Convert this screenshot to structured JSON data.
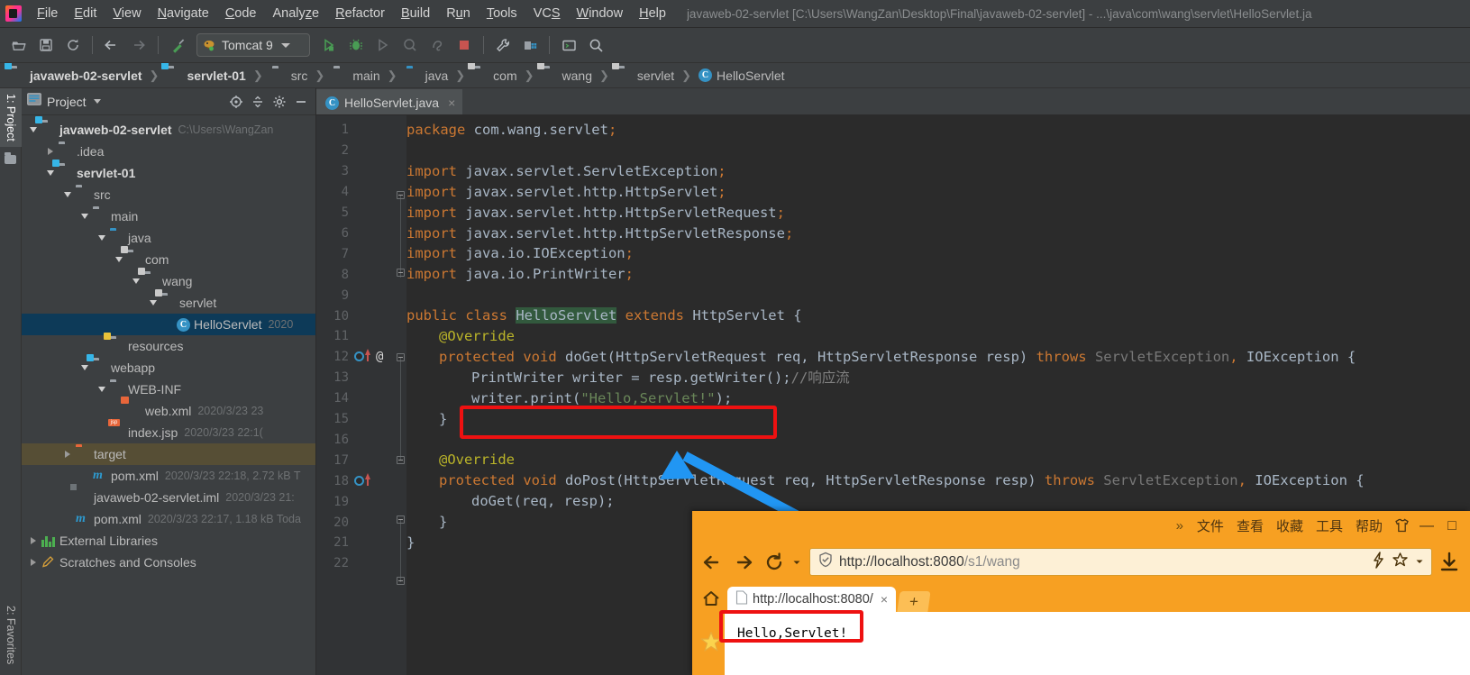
{
  "window": {
    "title": "javaweb-02-servlet [C:\\Users\\WangZan\\Desktop\\Final\\javaweb-02-servlet] - ...\\java\\com\\wang\\servlet\\HelloServlet.ja"
  },
  "menu": {
    "items": [
      {
        "label": "File",
        "mnemonic": "F"
      },
      {
        "label": "Edit",
        "mnemonic": "E"
      },
      {
        "label": "View",
        "mnemonic": "V"
      },
      {
        "label": "Navigate",
        "mnemonic": "N"
      },
      {
        "label": "Code",
        "mnemonic": "C"
      },
      {
        "label": "Analyze",
        "mnemonic": "z"
      },
      {
        "label": "Refactor",
        "mnemonic": "R"
      },
      {
        "label": "Build",
        "mnemonic": "B"
      },
      {
        "label": "Run",
        "mnemonic": "u"
      },
      {
        "label": "Tools",
        "mnemonic": "T"
      },
      {
        "label": "VCS",
        "mnemonic": "S"
      },
      {
        "label": "Window",
        "mnemonic": "W"
      },
      {
        "label": "Help",
        "mnemonic": "H"
      }
    ]
  },
  "toolbar": {
    "run_config": "Tomcat 9",
    "icons": [
      "open-folder-icon",
      "save-all-icon",
      "sync-icon",
      "back-icon",
      "forward-icon",
      "build-icon"
    ],
    "run_icons": [
      "run-icon",
      "debug-icon",
      "run-with-coverage-icon",
      "profile-icon",
      "attach-icon",
      "stop-icon"
    ],
    "right_icons": [
      "settings-icon",
      "project-structure-icon",
      "terminal-icon",
      "search-icon"
    ]
  },
  "breadcrumb": {
    "items": [
      {
        "label": "javaweb-02-servlet",
        "icon": "module-folder-icon",
        "bold": true
      },
      {
        "label": "servlet-01",
        "icon": "module-folder-icon",
        "bold": true
      },
      {
        "label": "src",
        "icon": "folder-icon",
        "bold": false
      },
      {
        "label": "main",
        "icon": "folder-icon",
        "bold": false
      },
      {
        "label": "java",
        "icon": "source-folder-icon",
        "bold": false
      },
      {
        "label": "com",
        "icon": "package-icon",
        "bold": false
      },
      {
        "label": "wang",
        "icon": "package-icon",
        "bold": false
      },
      {
        "label": "servlet",
        "icon": "package-icon",
        "bold": false
      },
      {
        "label": "HelloServlet",
        "icon": "class-icon",
        "bold": false
      }
    ]
  },
  "left_strip": {
    "project_tab": "1: Project",
    "favorites_tab": "2: Favorites"
  },
  "project_panel": {
    "title": "Project",
    "actions": [
      "locate-icon",
      "collapse-all-icon",
      "settings-icon",
      "hide-icon"
    ],
    "tree": [
      {
        "depth": 0,
        "label": "javaweb-02-servlet",
        "meta": "C:\\Users\\WangZan",
        "icon": "module-folder-icon",
        "expanded": true,
        "bold": true,
        "selected": false
      },
      {
        "depth": 1,
        "label": ".idea",
        "meta": "",
        "icon": "folder-icon",
        "expanded": false,
        "bold": false,
        "selected": false
      },
      {
        "depth": 1,
        "label": "servlet-01",
        "meta": "",
        "icon": "module-folder-icon",
        "expanded": true,
        "bold": true,
        "selected": false
      },
      {
        "depth": 2,
        "label": "src",
        "meta": "",
        "icon": "folder-icon",
        "expanded": true,
        "bold": false,
        "selected": false
      },
      {
        "depth": 3,
        "label": "main",
        "meta": "",
        "icon": "folder-icon",
        "expanded": true,
        "bold": false,
        "selected": false
      },
      {
        "depth": 4,
        "label": "java",
        "meta": "",
        "icon": "source-folder-icon",
        "expanded": true,
        "bold": false,
        "selected": false
      },
      {
        "depth": 5,
        "label": "com",
        "meta": "",
        "icon": "package-icon",
        "expanded": true,
        "bold": false,
        "selected": false
      },
      {
        "depth": 6,
        "label": "wang",
        "meta": "",
        "icon": "package-icon",
        "expanded": true,
        "bold": false,
        "selected": false
      },
      {
        "depth": 7,
        "label": "servlet",
        "meta": "",
        "icon": "package-icon",
        "expanded": true,
        "bold": false,
        "selected": false
      },
      {
        "depth": 8,
        "label": "HelloServlet",
        "meta": "2020",
        "icon": "class-icon",
        "expanded": null,
        "bold": false,
        "selected": true
      },
      {
        "depth": 4,
        "label": "resources",
        "meta": "",
        "icon": "resources-folder-icon",
        "expanded": null,
        "bold": false,
        "selected": false
      },
      {
        "depth": 3,
        "label": "webapp",
        "meta": "",
        "icon": "webapp-folder-icon",
        "expanded": true,
        "bold": false,
        "selected": false
      },
      {
        "depth": 4,
        "label": "WEB-INF",
        "meta": "",
        "icon": "folder-icon",
        "expanded": true,
        "bold": false,
        "selected": false
      },
      {
        "depth": 5,
        "label": "web.xml",
        "meta": "2020/3/23 23",
        "icon": "xml-file-icon",
        "expanded": null,
        "bold": false,
        "selected": false
      },
      {
        "depth": 4,
        "label": "index.jsp",
        "meta": "2020/3/23 22:1(",
        "icon": "jsp-file-icon",
        "expanded": null,
        "bold": false,
        "selected": false
      },
      {
        "depth": 2,
        "label": "target",
        "meta": "",
        "icon": "target-folder-icon",
        "expanded": false,
        "bold": false,
        "selected": false,
        "highlighted": true
      },
      {
        "depth": 3,
        "label": "pom.xml",
        "meta": "2020/3/23 22:18, 2.72 kB T",
        "icon": "maven-file-icon",
        "expanded": null,
        "bold": false,
        "selected": false
      },
      {
        "depth": 2,
        "label": "javaweb-02-servlet.iml",
        "meta": "2020/3/23 21:",
        "icon": "iml-file-icon",
        "expanded": null,
        "bold": false,
        "selected": false
      },
      {
        "depth": 2,
        "label": "pom.xml",
        "meta": "2020/3/23 22:17, 1.18 kB Toda",
        "icon": "maven-file-icon",
        "expanded": null,
        "bold": false,
        "selected": false
      },
      {
        "depth": 0,
        "label": "External Libraries",
        "meta": "",
        "icon": "libraries-icon",
        "expanded": false,
        "bold": false,
        "selected": false
      },
      {
        "depth": 0,
        "label": "Scratches and Consoles",
        "meta": "",
        "icon": "scratches-icon",
        "expanded": false,
        "bold": false,
        "selected": false
      }
    ]
  },
  "editor": {
    "tab": {
      "label": "HelloServlet.java",
      "icon": "class-icon",
      "close": "×"
    },
    "line_numbers": [
      1,
      2,
      3,
      4,
      5,
      6,
      7,
      8,
      9,
      10,
      11,
      12,
      13,
      14,
      15,
      16,
      17,
      18,
      19,
      20,
      21,
      22
    ],
    "code_lines": [
      {
        "n": 1,
        "indent": 0,
        "parts": [
          {
            "t": "package",
            "c": "k"
          },
          {
            "t": " com.wang.servlet",
            "c": "t"
          },
          {
            "t": ";",
            "c": "k"
          }
        ]
      },
      {
        "n": 2,
        "indent": 0,
        "parts": []
      },
      {
        "n": 3,
        "indent": 0,
        "parts": [
          {
            "t": "import",
            "c": "k"
          },
          {
            "t": " javax.servlet.ServletException",
            "c": "t"
          },
          {
            "t": ";",
            "c": "k"
          }
        ]
      },
      {
        "n": 4,
        "indent": 0,
        "parts": [
          {
            "t": "import",
            "c": "k"
          },
          {
            "t": " javax.servlet.http.HttpServlet",
            "c": "t"
          },
          {
            "t": ";",
            "c": "k"
          }
        ]
      },
      {
        "n": 5,
        "indent": 0,
        "parts": [
          {
            "t": "import",
            "c": "k"
          },
          {
            "t": " javax.servlet.http.HttpServletRequest",
            "c": "t"
          },
          {
            "t": ";",
            "c": "k"
          }
        ]
      },
      {
        "n": 6,
        "indent": 0,
        "parts": [
          {
            "t": "import",
            "c": "k"
          },
          {
            "t": " javax.servlet.http.HttpServletResponse",
            "c": "t"
          },
          {
            "t": ";",
            "c": "k"
          }
        ]
      },
      {
        "n": 7,
        "indent": 0,
        "parts": [
          {
            "t": "import",
            "c": "k"
          },
          {
            "t": " java.io.IOException",
            "c": "t"
          },
          {
            "t": ";",
            "c": "k"
          }
        ]
      },
      {
        "n": 8,
        "indent": 0,
        "parts": [
          {
            "t": "import",
            "c": "k"
          },
          {
            "t": " java.io.PrintWriter",
            "c": "t"
          },
          {
            "t": ";",
            "c": "k"
          }
        ]
      },
      {
        "n": 9,
        "indent": 0,
        "parts": []
      },
      {
        "n": 10,
        "indent": 0,
        "parts": [
          {
            "t": "public class",
            "c": "k"
          },
          {
            "t": " ",
            "c": "t"
          },
          {
            "t": "HelloServlet",
            "c": "hl"
          },
          {
            "t": " ",
            "c": "t"
          },
          {
            "t": "extends",
            "c": "k"
          },
          {
            "t": " HttpServlet {",
            "c": "t"
          }
        ]
      },
      {
        "n": 11,
        "indent": 1,
        "parts": [
          {
            "t": "@Override",
            "c": "a"
          }
        ]
      },
      {
        "n": 12,
        "indent": 1,
        "parts": [
          {
            "t": "protected void",
            "c": "k"
          },
          {
            "t": " ",
            "c": "t"
          },
          {
            "t": "doGet",
            "c": "t"
          },
          {
            "t": "(HttpServletRequest req, HttpServletResponse resp) ",
            "c": "t"
          },
          {
            "t": "throws",
            "c": "k"
          },
          {
            "t": " ",
            "c": "t"
          },
          {
            "t": "ServletException",
            "c": "dim"
          },
          {
            "t": ",",
            "c": "k"
          },
          {
            "t": " IOException {",
            "c": "t"
          }
        ]
      },
      {
        "n": 13,
        "indent": 2,
        "parts": [
          {
            "t": "PrintWriter writer = resp.getWriter();",
            "c": "t"
          },
          {
            "t": "//响应流",
            "c": "c"
          }
        ]
      },
      {
        "n": 14,
        "indent": 2,
        "parts": [
          {
            "t": "writer.print(",
            "c": "t"
          },
          {
            "t": "\"Hello,Servlet!\"",
            "c": "s"
          },
          {
            "t": ");",
            "c": "t"
          }
        ]
      },
      {
        "n": 15,
        "indent": 1,
        "parts": [
          {
            "t": "}",
            "c": "t"
          }
        ]
      },
      {
        "n": 16,
        "indent": 0,
        "parts": []
      },
      {
        "n": 17,
        "indent": 1,
        "parts": [
          {
            "t": "@Override",
            "c": "a"
          }
        ]
      },
      {
        "n": 18,
        "indent": 1,
        "parts": [
          {
            "t": "protected void",
            "c": "k"
          },
          {
            "t": " ",
            "c": "t"
          },
          {
            "t": "doPost",
            "c": "t"
          },
          {
            "t": "(HttpServletRequest req, HttpServletResponse resp) ",
            "c": "t"
          },
          {
            "t": "throws",
            "c": "k"
          },
          {
            "t": " ",
            "c": "t"
          },
          {
            "t": "ServletException",
            "c": "dim"
          },
          {
            "t": ",",
            "c": "k"
          },
          {
            "t": " IOException {",
            "c": "t"
          }
        ]
      },
      {
        "n": 19,
        "indent": 2,
        "parts": [
          {
            "t": "doGet(req, resp);",
            "c": "t"
          }
        ]
      },
      {
        "n": 20,
        "indent": 1,
        "parts": [
          {
            "t": "}",
            "c": "t"
          }
        ]
      },
      {
        "n": 21,
        "indent": 0,
        "parts": [
          {
            "t": "}",
            "c": "t"
          }
        ]
      },
      {
        "n": 22,
        "indent": 0,
        "parts": []
      }
    ],
    "gutter_markers": [
      {
        "line": 12,
        "icons": [
          "override-method-icon",
          "annotation-icon"
        ]
      },
      {
        "line": 18,
        "icons": [
          "override-method-icon"
        ]
      }
    ]
  },
  "annotations": {
    "code_highlight_rect": {
      "line": 14,
      "label": "red-highlight-box"
    },
    "browser_highlight_rect": {
      "label": "red-highlight-box"
    },
    "arrow": {
      "label": "blue-arrow",
      "color": "#2196f3"
    }
  },
  "browser": {
    "menu": [
      "文件",
      "查看",
      "收藏",
      "工具",
      "帮助"
    ],
    "chevron": "»",
    "skin_icon": "skin-tshirt-icon",
    "minimize": "—",
    "maximize": "□",
    "nav": {
      "back": "←",
      "forward": "→",
      "reload": "↺",
      "url_protocol": "http://localhost:8080",
      "url_path": "/s1/wang",
      "url_full": "http://localhost:8080/s1/wang",
      "shield_icon": "security-shield-icon",
      "right_icons": [
        "lightning-icon",
        "star-icon",
        "dropdown-caret-icon",
        "download-icon"
      ]
    },
    "home_icon": "home-icon",
    "tab": {
      "title": "http://localhost:8080/",
      "close": "×"
    },
    "new_tab": "+",
    "page_content": "Hello,Servlet!",
    "favorite_star_icon": "favorite-star-icon"
  },
  "colors": {
    "ide_bg": "#3c3f41",
    "editor_bg": "#2b2b2b",
    "accent_blue": "#3592c4",
    "selection_blue": "#0d3a58",
    "highlight_red": "#ee1111",
    "arrow_blue": "#2196f3",
    "browser_orange": "#f7a022",
    "keyword_orange": "#cc7832",
    "string_green": "#6a8759"
  }
}
